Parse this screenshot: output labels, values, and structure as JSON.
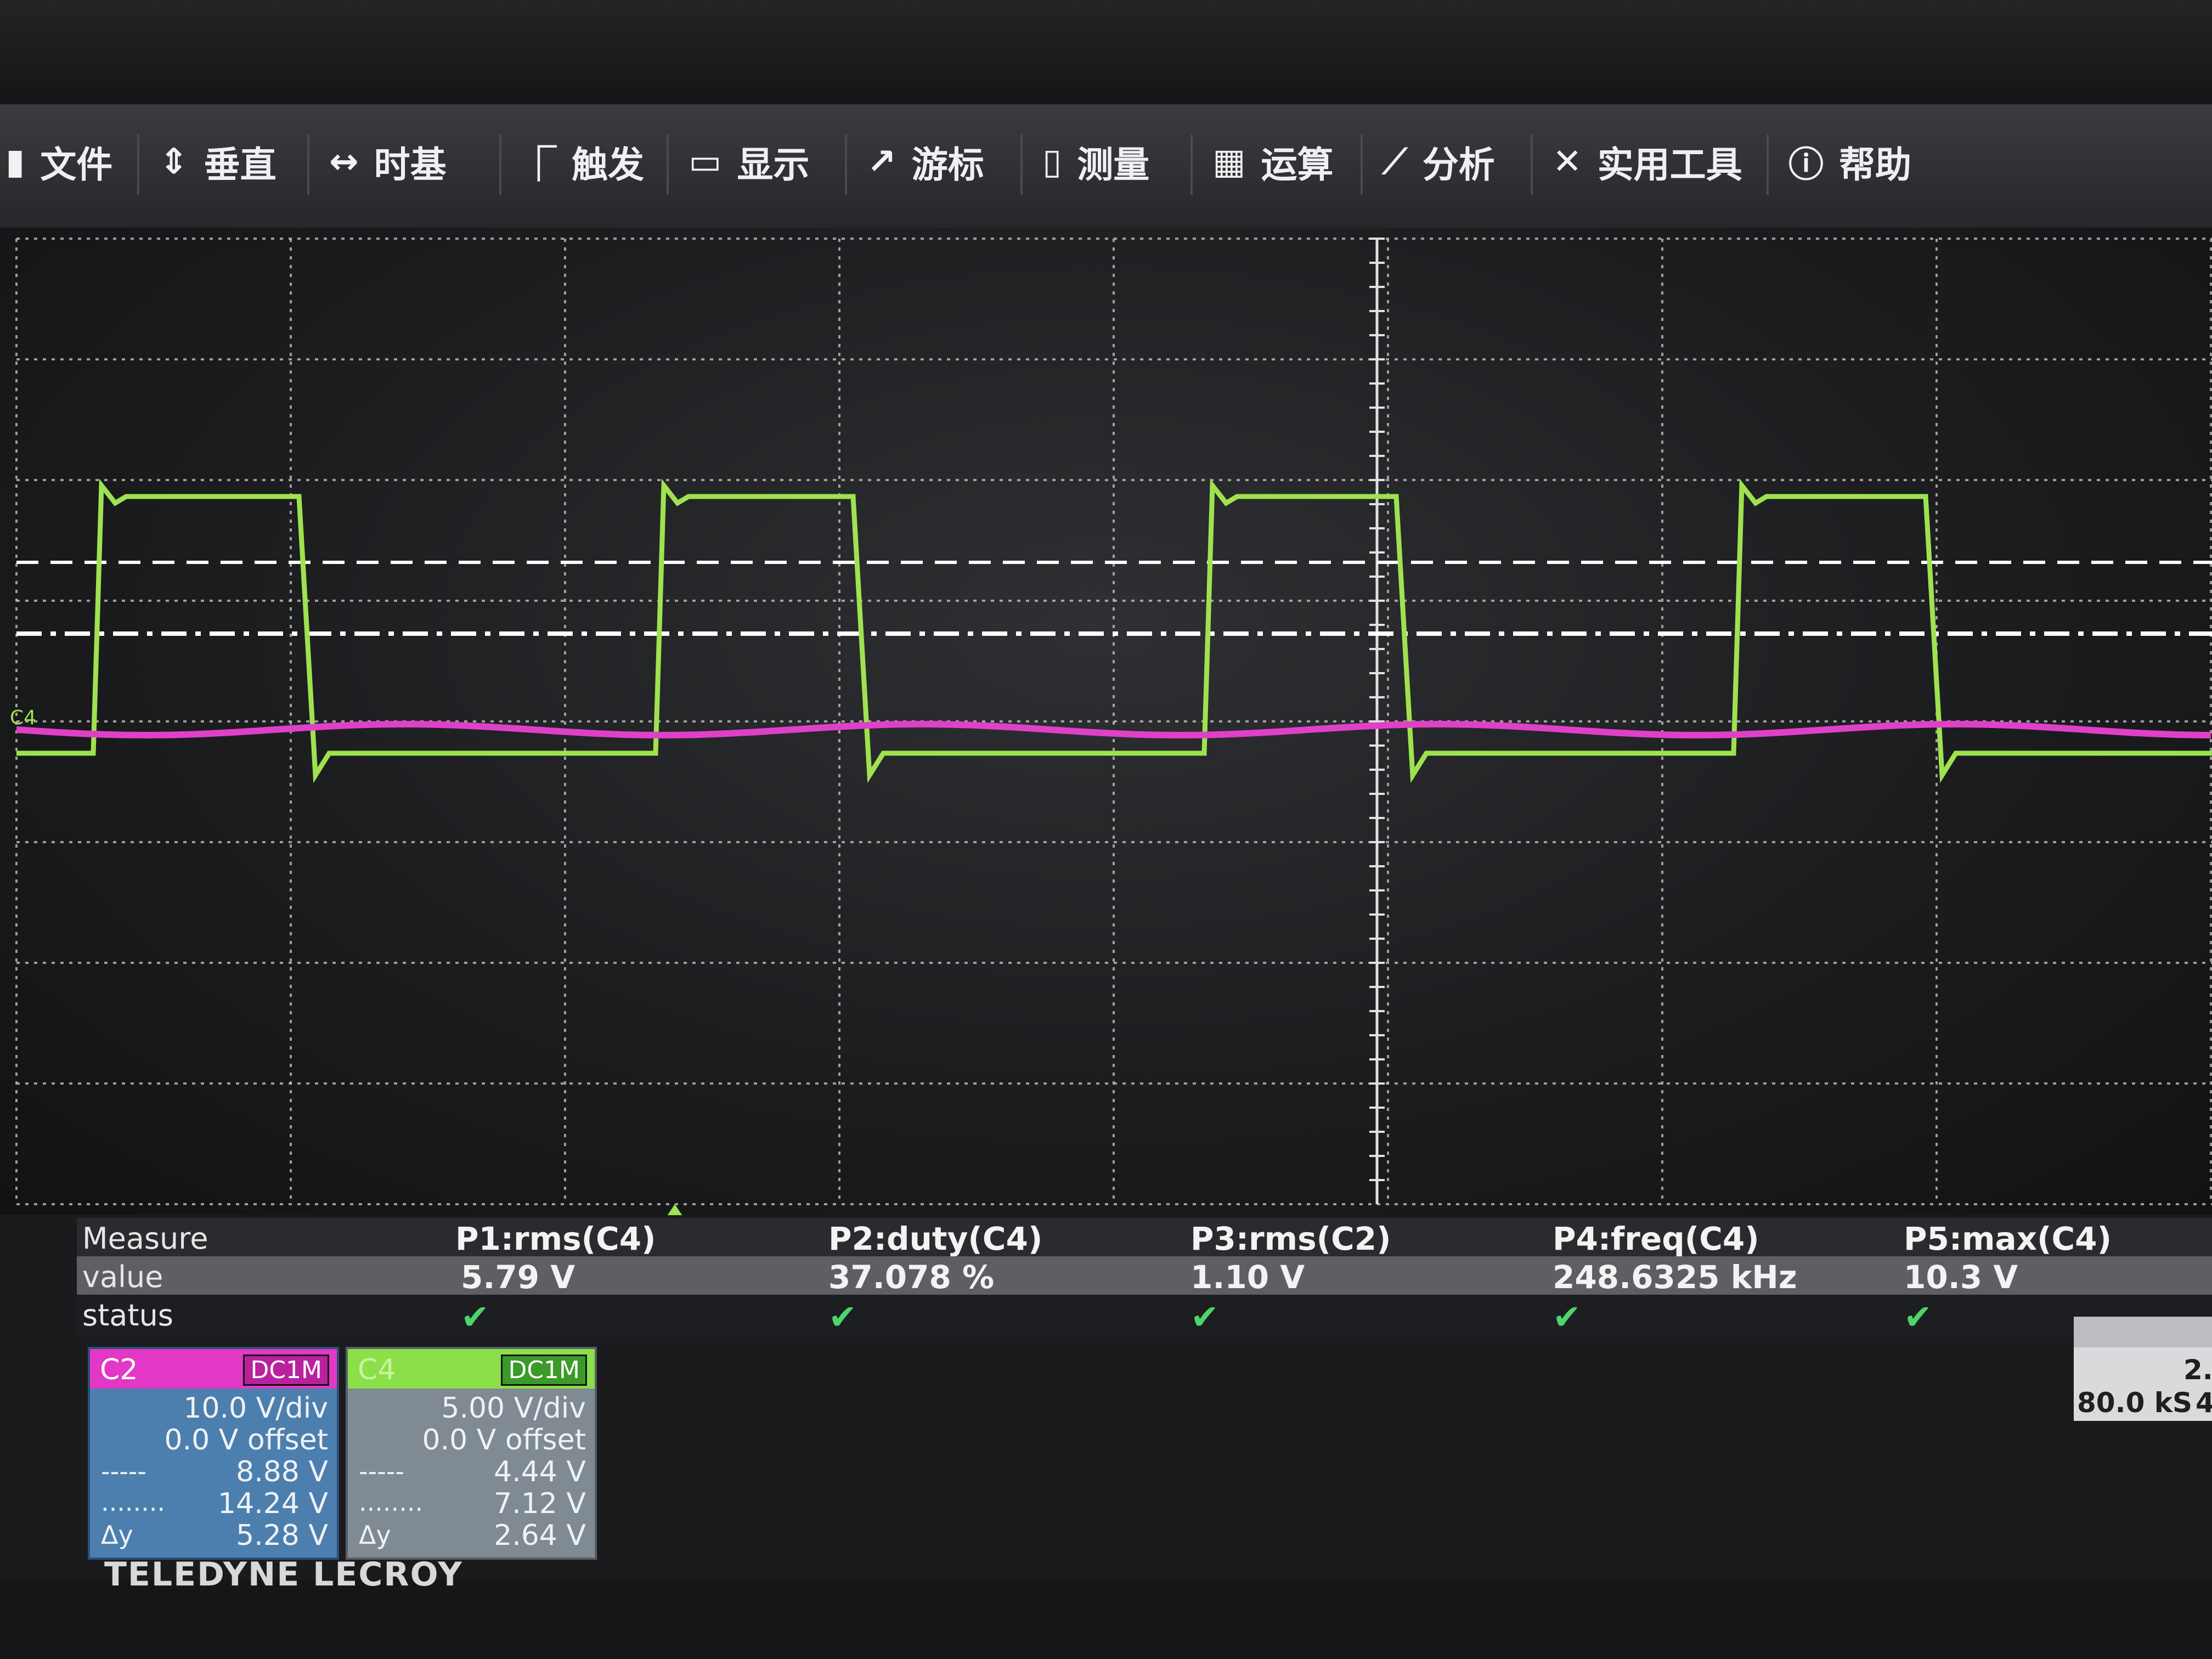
{
  "menu": {
    "items": [
      {
        "label": "文件",
        "icon": "file-icon",
        "glyph": "▮"
      },
      {
        "label": "垂直",
        "icon": "vertical-icon",
        "glyph": "⇕"
      },
      {
        "label": "时基",
        "icon": "timebase-icon",
        "glyph": "↔"
      },
      {
        "label": "触发",
        "icon": "trigger-icon",
        "glyph": "⎾"
      },
      {
        "label": "显示",
        "icon": "display-icon",
        "glyph": "▭"
      },
      {
        "label": "游标",
        "icon": "cursor-icon",
        "glyph": "↗"
      },
      {
        "label": "测量",
        "icon": "measure-icon",
        "glyph": "▯"
      },
      {
        "label": "运算",
        "icon": "math-icon",
        "glyph": "▦"
      },
      {
        "label": "分析",
        "icon": "analysis-icon",
        "glyph": "⟋"
      },
      {
        "label": "实用工具",
        "icon": "tools-icon",
        "glyph": "✕"
      },
      {
        "label": "帮助",
        "icon": "help-icon",
        "glyph": "ⓘ"
      }
    ]
  },
  "plot": {
    "channel_marker": "C4",
    "colors": {
      "c2": "#e040c8",
      "c4": "#9ee34f",
      "grid": "#c9c9c9"
    }
  },
  "measure": {
    "row_labels": {
      "header": "Measure",
      "value": "value",
      "status": "status"
    },
    "params": [
      {
        "name": "P1:rms(C4)",
        "value": "5.79 V"
      },
      {
        "name": "P2:duty(C4)",
        "value": "37.078 %"
      },
      {
        "name": "P3:rms(C2)",
        "value": "1.10 V"
      },
      {
        "name": "P4:freq(C4)",
        "value": "248.6325 kHz"
      },
      {
        "name": "P5:max(C4)",
        "value": "10.3 V"
      }
    ],
    "status_glyph": "✔"
  },
  "channels": {
    "c2": {
      "name": "C2",
      "coupling": "DC1M",
      "vdiv": "10.0 V/div",
      "offset": "0.0 V offset",
      "cursor1_label": "-----",
      "cursor1": "8.88 V",
      "cursor2_label": "........",
      "cursor2": "14.24 V",
      "delta_label": "Δy",
      "delta": "5.28 V"
    },
    "c4": {
      "name": "C4",
      "coupling": "DC1M",
      "vdiv": "5.00 V/div",
      "offset": "0.0 V offset",
      "cursor1_label": "-----",
      "cursor1": "4.44 V",
      "cursor2_label": "........",
      "cursor2": "7.12 V",
      "delta_label": "Δy",
      "delta": "2.64 V"
    }
  },
  "timebase": {
    "line1": "2.",
    "line2": "80.0 kS",
    "line3": "4"
  },
  "brand": "TELEDYNE LECROY"
}
